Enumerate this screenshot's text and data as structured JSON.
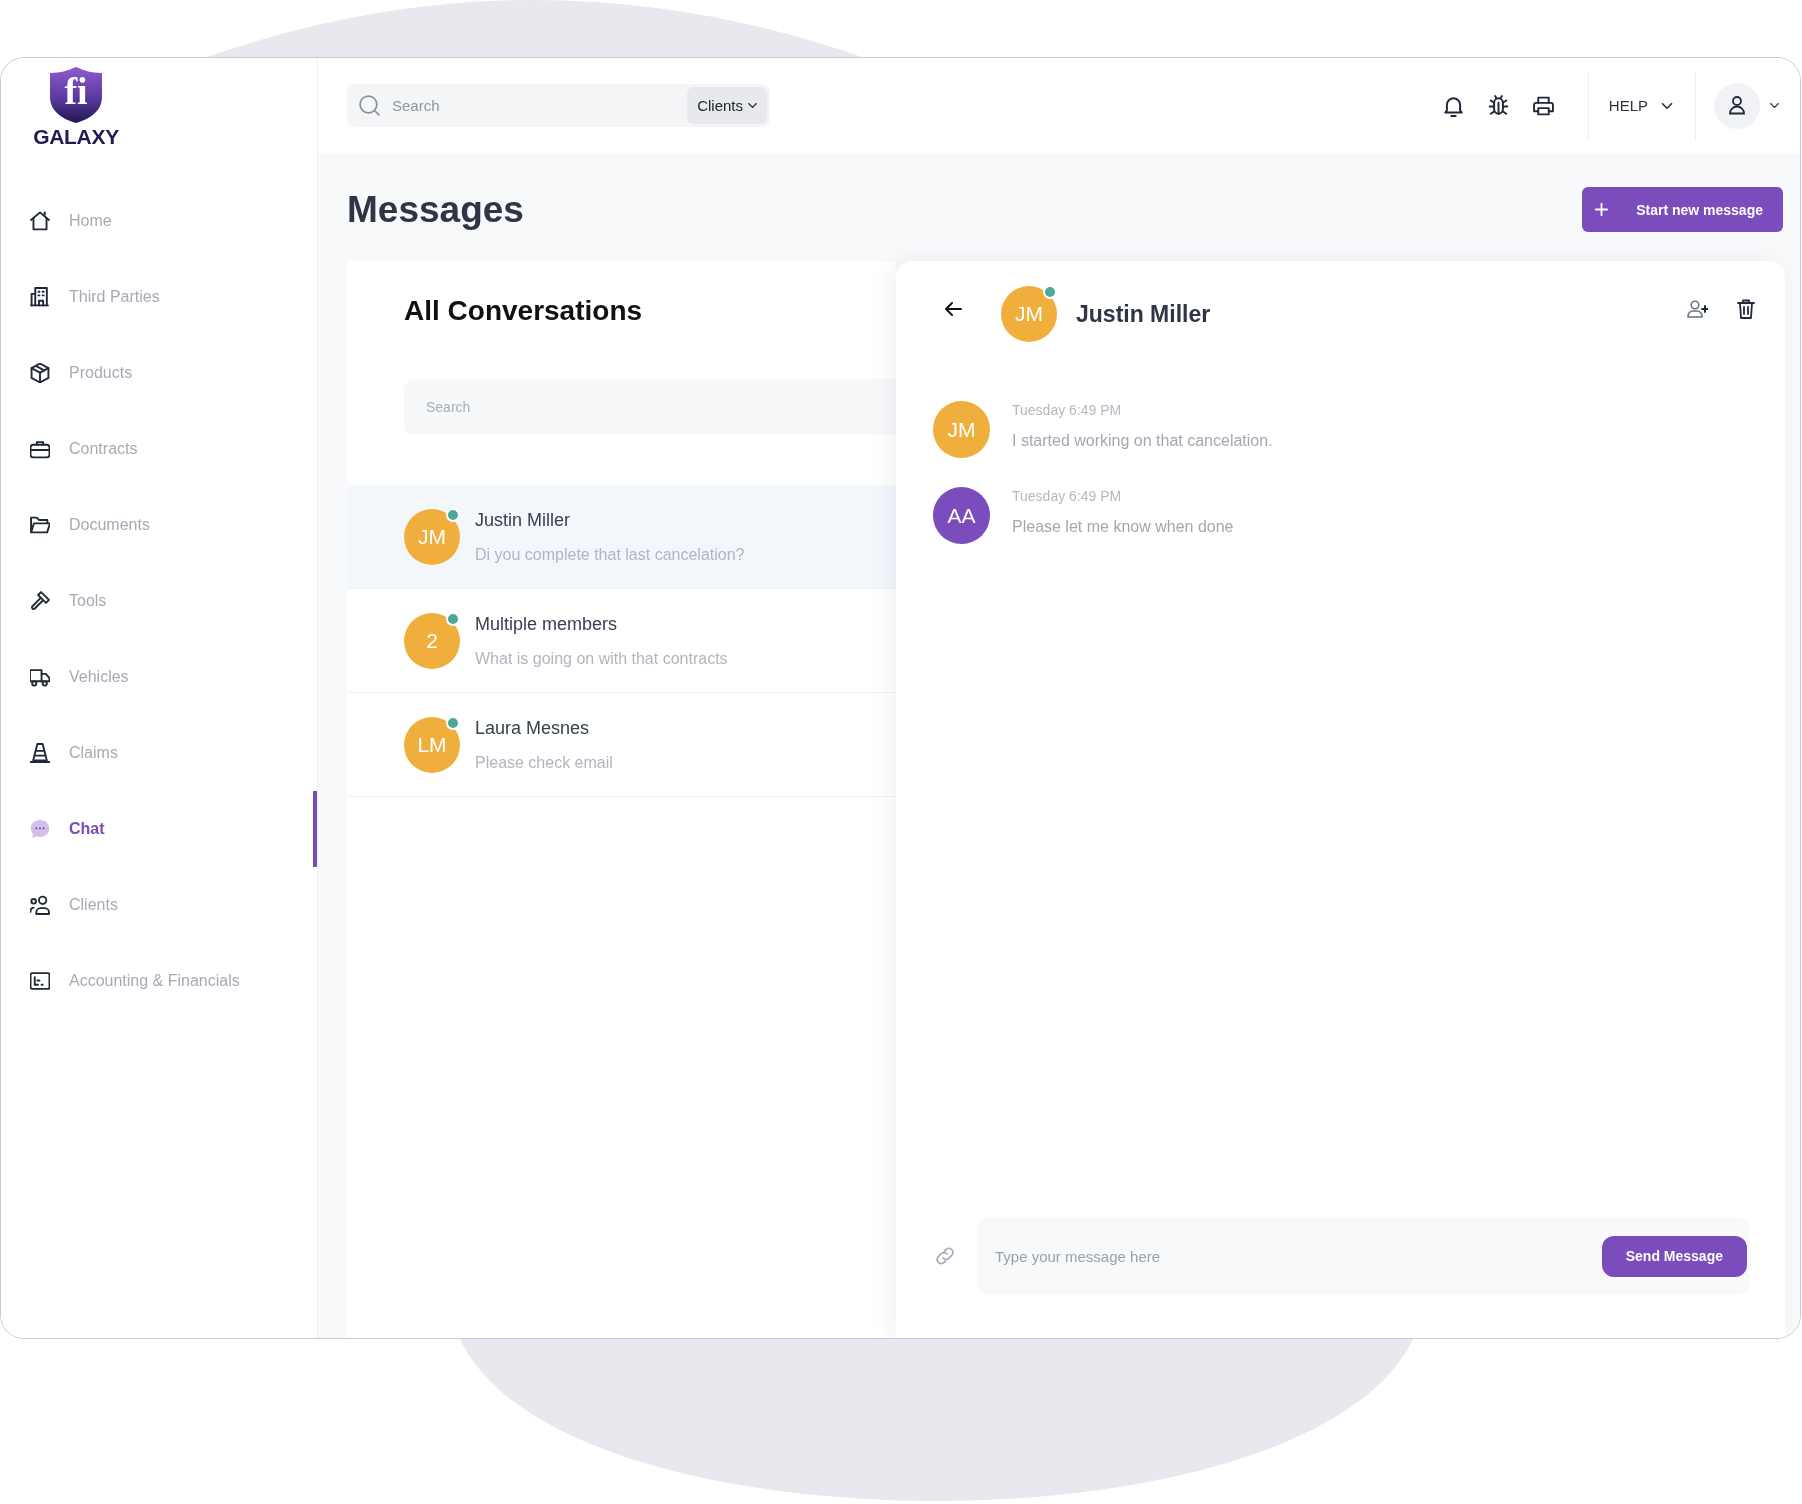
{
  "logo": {
    "monogram": "fi",
    "wordmark": "GALAXY"
  },
  "sidebar": {
    "items": [
      {
        "label": "Home",
        "selected": false
      },
      {
        "label": "Third Parties",
        "selected": false
      },
      {
        "label": "Products",
        "selected": false
      },
      {
        "label": "Contracts",
        "selected": false
      },
      {
        "label": "Documents",
        "selected": false
      },
      {
        "label": "Tools",
        "selected": false
      },
      {
        "label": "Vehicles",
        "selected": false
      },
      {
        "label": "Claims",
        "selected": false
      },
      {
        "label": "Chat",
        "selected": true
      },
      {
        "label": "Clients",
        "selected": false
      },
      {
        "label": "Accounting & Financials",
        "selected": false
      }
    ]
  },
  "top_bar": {
    "search": {
      "placeholder": "Search"
    },
    "scope": {
      "label": "Clients"
    },
    "help": {
      "label": "HELP"
    }
  },
  "page": {
    "title": "Messages",
    "new_message_button": {
      "label": "Start new message"
    }
  },
  "conversations": {
    "title": "All Conversations",
    "search": {
      "placeholder": "Search"
    },
    "items": [
      {
        "initials": "JM",
        "name": "Justin Miller",
        "preview": "Di you complete that last cancelation?",
        "online": true,
        "selected": true
      },
      {
        "initials": "2",
        "name": "Multiple members",
        "preview": "What is going on with that contracts",
        "online": true,
        "selected": false
      },
      {
        "initials": "LM",
        "name": "Laura Mesnes",
        "preview": "Please check email",
        "online": true,
        "selected": false
      }
    ]
  },
  "chat": {
    "contact": {
      "initials": "JM",
      "name": "Justin Miller",
      "online": true
    },
    "messages": [
      {
        "initials": "JM",
        "color": "#f0ae3d",
        "time": "Tuesday 6:49 PM",
        "text": "I started working on that cancelation."
      },
      {
        "initials": "AA",
        "color": "#7b4cbc",
        "time": "Tuesday 6:49 PM",
        "text": "Please let me know when done"
      }
    ],
    "composer": {
      "placeholder": "Type your message here",
      "send_label": "Send Message"
    }
  }
}
